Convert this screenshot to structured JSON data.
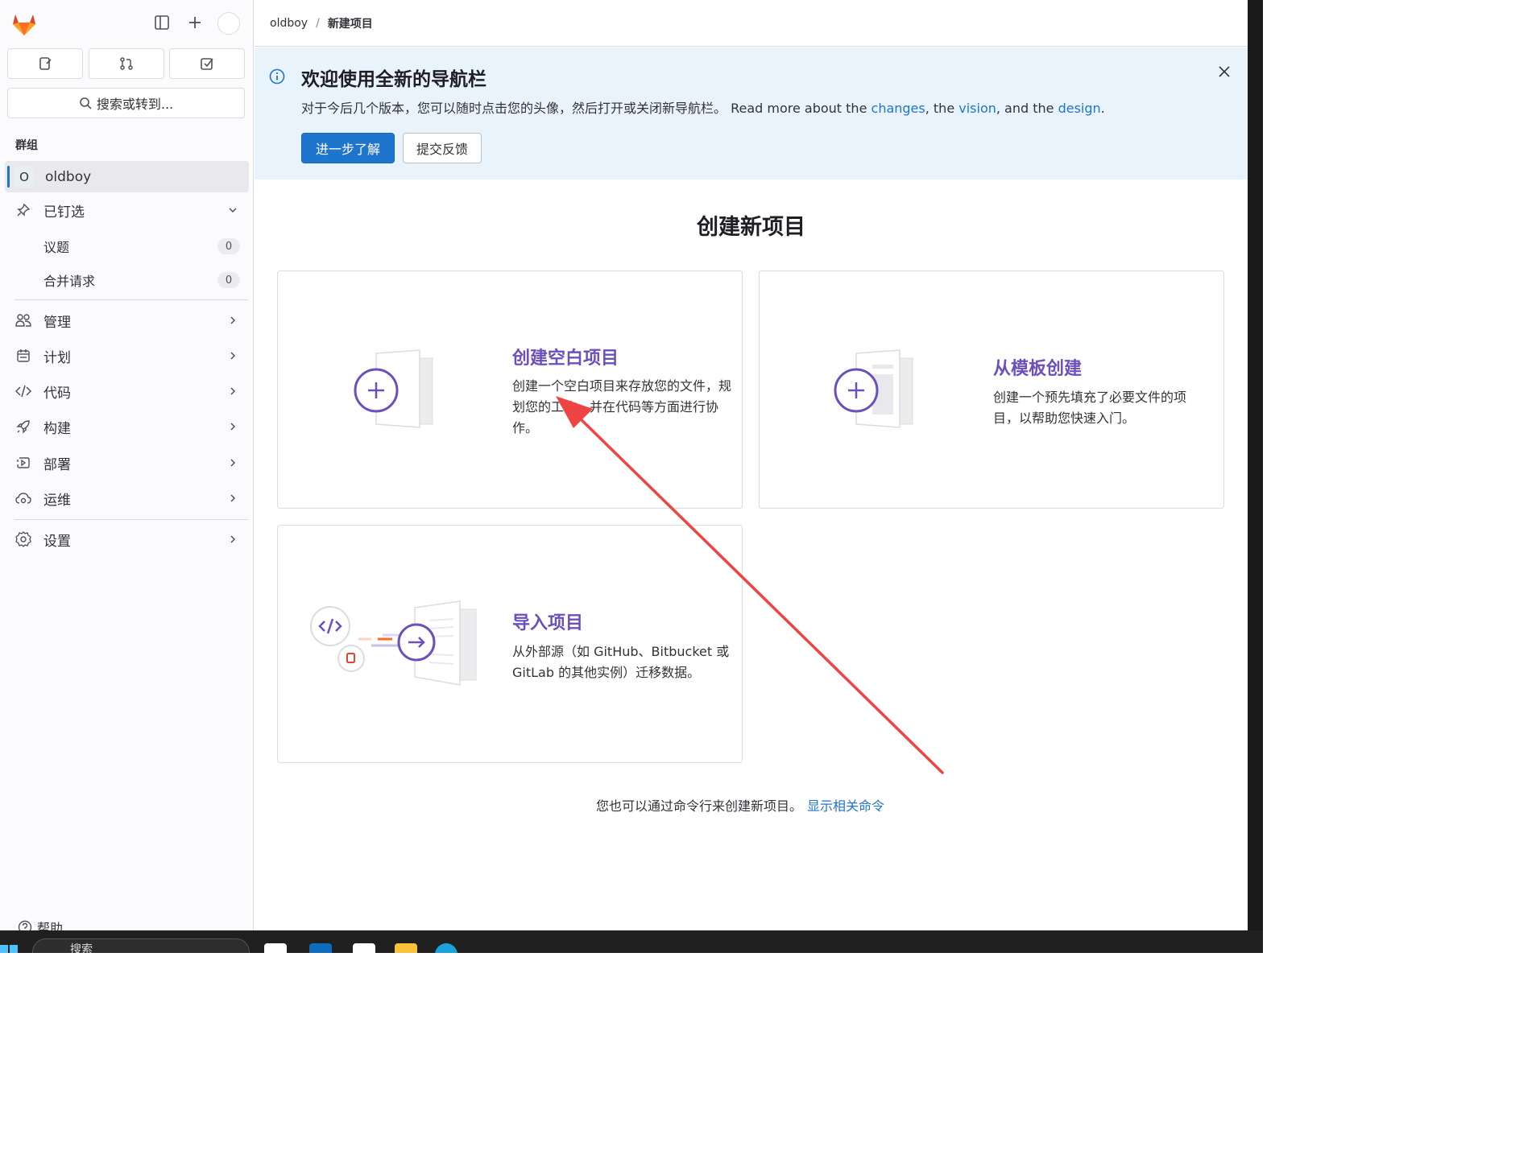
{
  "sidebar": {
    "search_label": "搜索或转到...",
    "section_label": "群组",
    "context": {
      "avatar_letter": "O",
      "name": "oldboy"
    },
    "pinned": {
      "label": "已钉选",
      "items": [
        {
          "label": "议题",
          "count": "0"
        },
        {
          "label": "合并请求",
          "count": "0"
        }
      ]
    },
    "nav": [
      {
        "label": "管理",
        "icon": "users-icon"
      },
      {
        "label": "计划",
        "icon": "planning-icon"
      },
      {
        "label": "代码",
        "icon": "code-icon"
      },
      {
        "label": "构建",
        "icon": "rocket-icon"
      },
      {
        "label": "部署",
        "icon": "deployments-icon"
      },
      {
        "label": "运维",
        "icon": "cloud-gear-icon"
      },
      {
        "label": "设置",
        "icon": "settings-icon"
      }
    ],
    "help_label": "帮助"
  },
  "breadcrumb": {
    "parent": "oldboy",
    "separator": "/",
    "current": "新建项目"
  },
  "banner": {
    "title": "欢迎使用全新的导航栏",
    "text_prefix": "对于今后几个版本，您可以随时点击您的头像，然后打开或关闭新导航栏。 Read more about the ",
    "link_changes": "changes",
    "text_mid1": ", the ",
    "link_vision": "vision",
    "text_mid2": ", and the ",
    "link_design": "design",
    "text_suffix": ".",
    "primary_button": "进一步了解",
    "secondary_button": "提交反馈"
  },
  "main": {
    "title": "创建新项目",
    "cards": [
      {
        "title": "创建空白项目",
        "description": "创建一个空白项目来存放您的文件，规划您的工作，并在代码等方面进行协作。"
      },
      {
        "title": "从模板创建",
        "description": "创建一个预先填充了必要文件的项目，以帮助您快速入门。"
      },
      {
        "title": "导入项目",
        "description": "从外部源（如 GitHub、Bitbucket 或 GitLab 的其他实例）迁移数据。"
      }
    ],
    "cli_note": "您也可以通过命令行来创建新项目。",
    "cli_link": "显示相关命令"
  },
  "taskbar": {
    "search_placeholder": "搜索"
  },
  "colors": {
    "accent_purple": "#6b4fbb",
    "link_blue": "#1f75cb",
    "annotation_red": "#ef4444",
    "banner_bg": "#e9f3fc"
  }
}
